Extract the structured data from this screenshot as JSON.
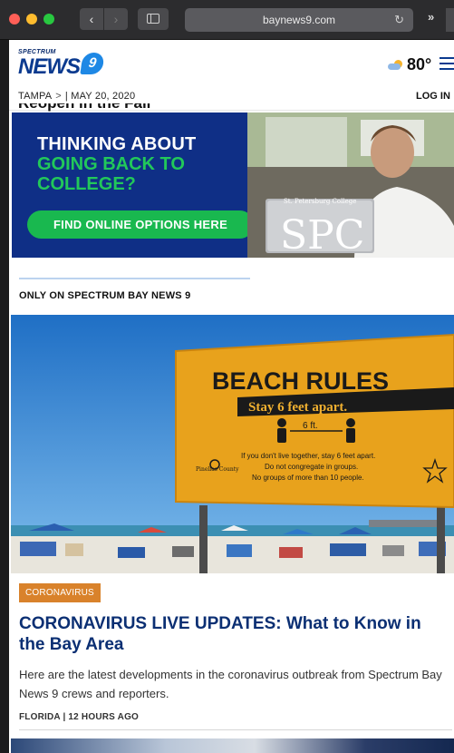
{
  "browser": {
    "url": "baynews9.com",
    "back_glyph": "‹",
    "forward_glyph": "›",
    "reload_glyph": "↻",
    "more_glyph": "»"
  },
  "header": {
    "logo_small": "SPECTRUM",
    "logo_big": "NEWS",
    "logo_badge": "9",
    "temperature": "80°",
    "location": "TAMPA",
    "crumb_sep": ">",
    "date": "| MAY 20, 2020",
    "login": "LOG IN",
    "clipped_title": "Reopen in the Fall"
  },
  "ad": {
    "line1": "THINKING ABOUT",
    "line2": "GOING BACK TO",
    "line3": "COLLEGE?",
    "cta": "FIND ONLINE OPTIONS HERE",
    "college_small": "St. Petersburg College",
    "college_logo": "SPC"
  },
  "section": {
    "label": "ONLY ON SPECTRUM BAY NEWS 9"
  },
  "hero_sign": {
    "title": "BEACH RULES",
    "subtitle": "Stay 6 feet apart.",
    "distance": "6 ft.",
    "line1": "If you don't live together, stay 6 feet apart.",
    "line2": "Do not congregate in groups.",
    "line3": "No groups of more than 10 people.",
    "county": "Pinellas County"
  },
  "article": {
    "tag": "CORONAVIRUS",
    "headline": "CORONAVIRUS LIVE UPDATES: What to Know in the Bay Area",
    "summary": "Here are the latest developments in the coronavirus outbreak from Spectrum Bay News 9 crews and reporters.",
    "meta": "FLORIDA | 12 HOURS AGO"
  },
  "colors": {
    "brand_blue": "#0b3a8f",
    "ad_green": "#22c85a",
    "tag_orange": "#d9822b",
    "headline_navy": "#0b2f73"
  }
}
